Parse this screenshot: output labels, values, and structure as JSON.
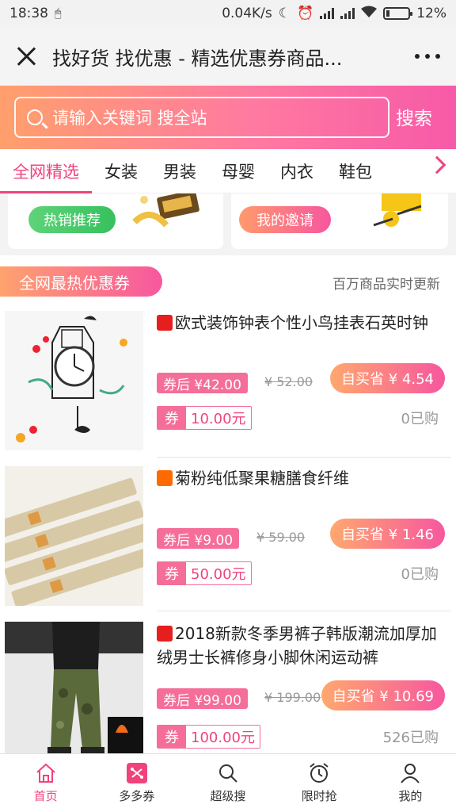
{
  "status_bar": {
    "time": "18:38",
    "network_speed": "0.04K/s",
    "battery": "12%"
  },
  "title_bar": {
    "title": "找好货 找优惠 - 精选优惠券商品..."
  },
  "search": {
    "placeholder": "请输入关键词 搜全站",
    "button_label": "搜索"
  },
  "tabs": [
    "全网精选",
    "女装",
    "男装",
    "母婴",
    "内衣",
    "鞋包"
  ],
  "promo": {
    "left_label": "热销推荐",
    "right_label": "我的邀请"
  },
  "section": {
    "title": "全网最热优惠券",
    "subtitle": "百万商品实时更新"
  },
  "products": [
    {
      "shop_badge": "天猫",
      "title": "欧式装饰钟表个性小鸟挂表石英时钟",
      "after_price": "券后 ¥42.00",
      "orig_price": "¥ 52.00",
      "save": "自买省 ¥ 4.54",
      "coupon_label": "券",
      "coupon_value": "10.00元",
      "sold": "0已购"
    },
    {
      "shop_badge": "淘",
      "title": "菊粉纯低聚果糖膳食纤维",
      "after_price": "券后 ¥9.00",
      "orig_price": "¥ 59.00",
      "save": "自买省 ¥ 1.46",
      "coupon_label": "券",
      "coupon_value": "50.00元",
      "sold": "0已购"
    },
    {
      "shop_badge": "天猫",
      "title": "2018新款冬季男裤子韩版潮流加厚加绒男士长裤修身小脚休闲运动裤",
      "after_price": "券后 ¥99.00",
      "orig_price": "¥ 199.00",
      "save": "自买省 ¥ 10.69",
      "coupon_label": "券",
      "coupon_value": "100.00元",
      "sold": "526已购"
    }
  ],
  "bottom_nav": [
    {
      "label": "首页",
      "icon": "home-icon"
    },
    {
      "label": "多多券",
      "icon": "coupon-icon"
    },
    {
      "label": "超级搜",
      "icon": "search-icon"
    },
    {
      "label": "限时抢",
      "icon": "alarm-clock-icon"
    },
    {
      "label": "我的",
      "icon": "user-icon"
    }
  ],
  "colors": {
    "accent": "#f0437c",
    "gradient_start": "#ff9f6c",
    "gradient_end": "#f75aa8"
  }
}
